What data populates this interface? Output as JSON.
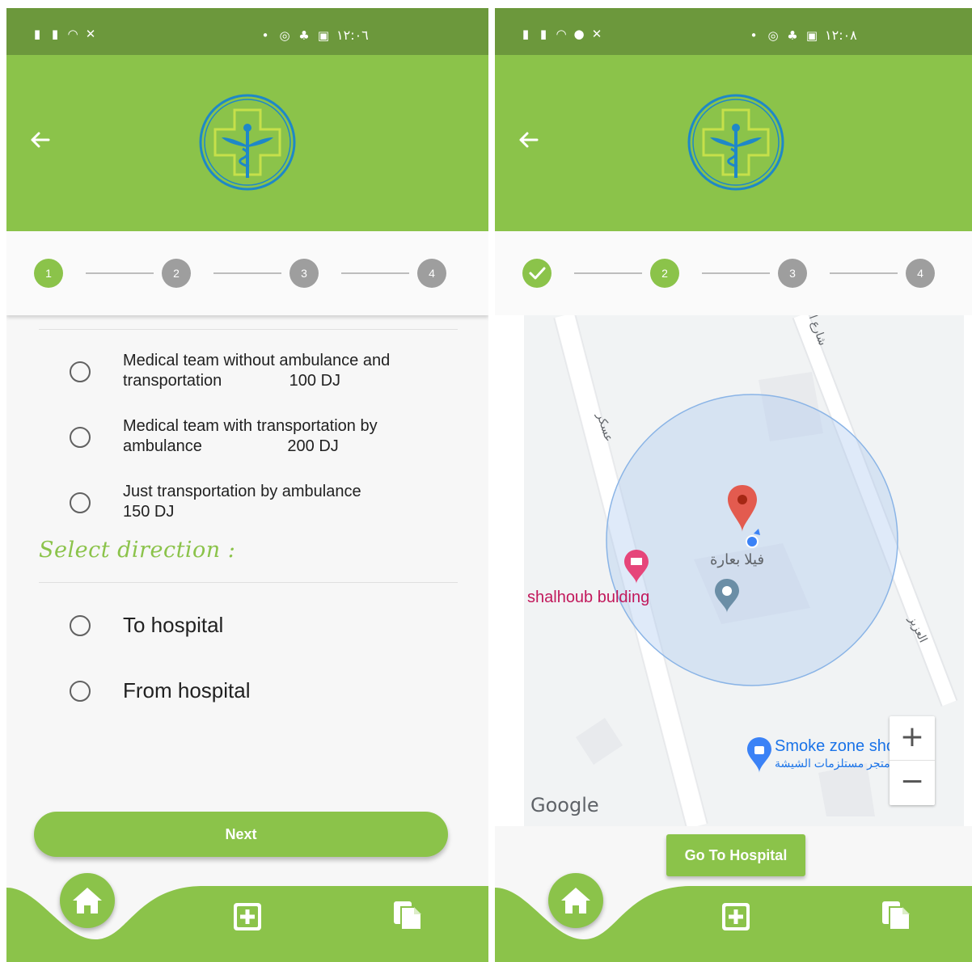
{
  "colors": {
    "primary": "#8bc34a",
    "status_bar": "#6c983c",
    "inactive_step": "#9e9e9e",
    "pin_red": "#e35b4f",
    "poi_pink": "#e6457a",
    "map_blue": "#3b82f6"
  },
  "left_screen": {
    "status_bar": {
      "time": "١٢:٠٦"
    },
    "stepper": {
      "steps": [
        "1",
        "2",
        "3",
        "4"
      ],
      "active_step": 1
    },
    "service_options": [
      {
        "line1": "Medical team without ambulance and",
        "line2": "transportation               100 DJ"
      },
      {
        "line1": "Medical team with transportation by",
        "line2": "ambulance                   200 DJ"
      },
      {
        "line1": "Just transportation by ambulance",
        "line2": "150 DJ"
      }
    ],
    "direction_title": "Select direction :",
    "direction_options": [
      "To hospital",
      "From hospital"
    ],
    "next_label": "Next"
  },
  "right_screen": {
    "status_bar": {
      "time": "١٢:٠٨"
    },
    "stepper": {
      "steps": [
        "✓",
        "2",
        "3",
        "4"
      ],
      "active_step": 2
    },
    "map": {
      "street_top": "شارع ا",
      "street_left": "عسكر",
      "street_right": "العزيز",
      "place_arabic": "فيلا بعارة",
      "poi_building": "shalhoub bulding",
      "poi_shop": "Smoke zone shop",
      "poi_shop_arabic": "متجر مستلزمات الشيشة",
      "attribution": "Google",
      "zoom_in": "+",
      "zoom_out": "−"
    },
    "go_label": "Go To Hospital"
  },
  "icons": [
    "back-arrow-icon",
    "medical-caduceus-logo",
    "home-icon",
    "medical-add-icon",
    "documents-icon",
    "map-pin-icon",
    "hotel-icon",
    "shopping-bag-icon",
    "check-icon"
  ]
}
